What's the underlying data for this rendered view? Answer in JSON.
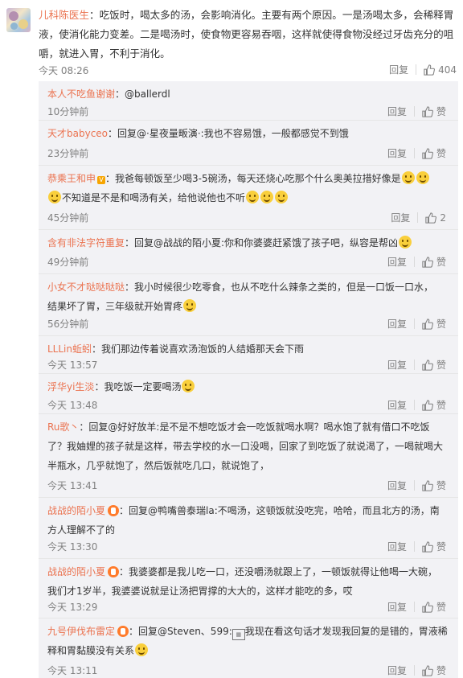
{
  "main": {
    "user": "儿科陈医生",
    "text": "：吃饭时，喝太多的汤，会影响消化。主要有两个原因。一是汤喝太多，会稀释胃液，使消化能力变差。二是喝汤时，使食物更容易吞咽，这样就使得食物没经过牙齿充分的咀嚼，就进入胃，不利于消化。",
    "time": "今天 08:26",
    "reply_label": "回复",
    "likes": "404"
  },
  "replies": [
    {
      "user": "本人不吃鱼谢谢",
      "text": "：@ballerdl",
      "time": "10分钟前",
      "reply_label": "回复",
      "like_label": "赞"
    },
    {
      "user": "天才babyceo",
      "text": "：回复@·星夜量畈演·:我也不容易饿，一般都感觉不到饿",
      "time": "23分钟前",
      "reply_label": "回复",
      "like_label": "赞"
    },
    {
      "user": "恭乘王和申",
      "text1": "：我爸每顿饭至少喝3-5碗汤，每天还烧心吃那个什么奥美拉措好像是",
      "text2": "不知道是不是和喝汤有关，给他说他也不听",
      "time": "45分钟前",
      "reply_label": "回复",
      "like_label": "2"
    },
    {
      "user": "含有非法字符重复",
      "text": "：回复@战战的陌小夏:你和你婆婆赶紧饿了孩子吧，纵容是帮凶",
      "time": "49分钟前",
      "reply_label": "回复",
      "like_label": "赞"
    },
    {
      "user": "小女不才哒哒哒哒",
      "text1": "：我小时候很少吃零食，也从不吃什么辣条之类的，但是一口饭一口水，",
      "text2": "结果坏了胃，三年级就开始胃疼",
      "time": "56分钟前",
      "reply_label": "回复",
      "like_label": "赞"
    },
    {
      "user": "LLLin蚯蚓",
      "text": "：我们那边传着说喜欢汤泡饭的人结婚那天会下雨",
      "time": "今天 13:57",
      "reply_label": "回复",
      "like_label": "赞"
    },
    {
      "user": "浮华yi生淡",
      "text": "：我吃饭一定要喝汤",
      "time": "今天 13:48",
      "reply_label": "回复",
      "like_label": "赞"
    },
    {
      "user": "Ru歌丶",
      "text1": "：回复@好好放羊:是不是不想吃饭才会一吃饭就喝水啊？喝水饱了就有借口不吃饭",
      "text2": "了？我妯娌的孩子就是这样，带去学校的水一口没喝，回家了到吃饭了就说渴了，一喝就喝大",
      "text3": "半瓶水，几乎就饱了，然后饭就吃几口，就说饱了，",
      "time": "今天 13:41",
      "reply_label": "回复",
      "like_label": "赞"
    },
    {
      "user": "战战的陌小夏",
      "text1": "：回复@鸭嘴兽泰瑞la:不喝汤，这顿饭就没吃完，哈哈，而且北方的汤，南",
      "text2": "方人理解不了的",
      "time": "今天 13:30",
      "reply_label": "回复",
      "like_label": "赞"
    },
    {
      "user": "战战的陌小夏",
      "text1": "：我婆婆都是我儿吃一口，还没嚼汤就跟上了，一顿饭就得让他喝一大碗，",
      "text2": "我们才1岁半，我婆婆说就是让汤把胃撑的大大的，这样才能吃的多，哎",
      "time": "今天 13:29",
      "reply_label": "回复",
      "like_label": "赞"
    },
    {
      "user": "九号伊伐布雷定",
      "text1": "：回复@Steven、599:",
      "text1b": "我现在看这句话才发现我回复的是错的，胃液稀",
      "text2": "释和胃黏膜没有关系",
      "time": "今天 13:11",
      "reply_label": "回复",
      "like_label": "赞"
    }
  ]
}
